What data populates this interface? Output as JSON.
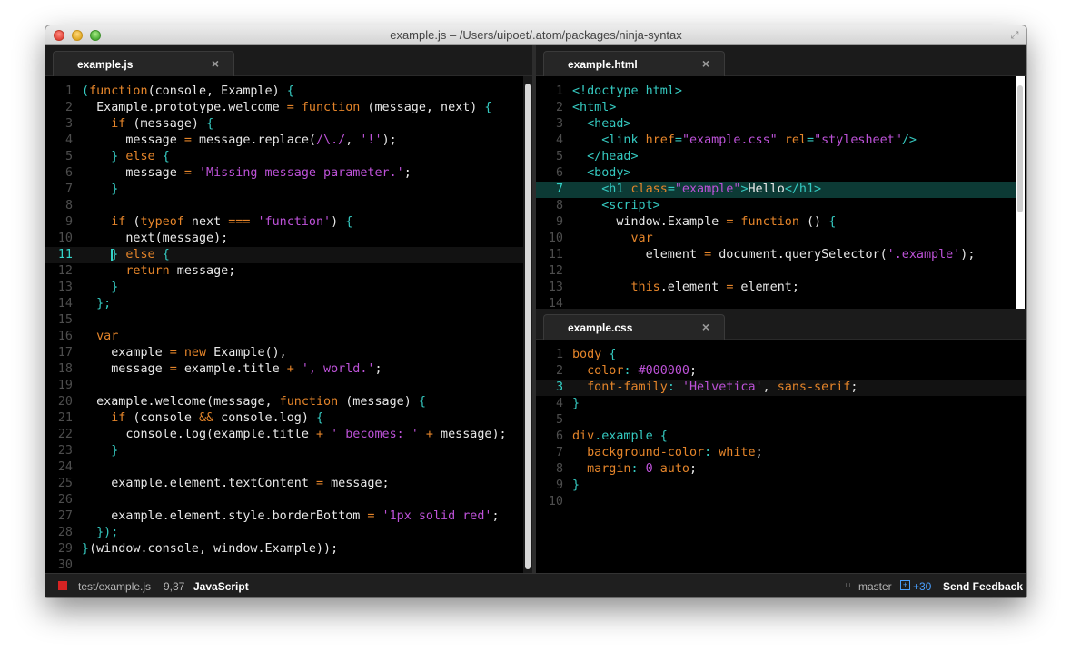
{
  "window": {
    "title": "example.js – /Users/uipoet/.atom/packages/ninja-syntax"
  },
  "left_pane": {
    "tab_label": "example.js",
    "close_glyph": "×"
  },
  "right_top_pane": {
    "tab_label": "example.html",
    "close_glyph": "×"
  },
  "right_bottom_pane": {
    "tab_label": "example.css",
    "close_glyph": "×"
  },
  "status": {
    "file_path": "test/example.js",
    "cursor": "9,37",
    "grammar": "JavaScript",
    "branch": "master",
    "diff_count": "+30",
    "feedback_label": "Send Feedback"
  },
  "colors": {
    "keyword": "#e5852a",
    "string": "#bd52d8",
    "punctuation": "#35c9c0",
    "text": "#e8e8e8",
    "gutter": "#4d4d4d",
    "cursor_line": "#34d2c7"
  },
  "icons": [
    "close-light-icon",
    "minimize-light-icon",
    "maximize-light-icon",
    "fullscreen-icon",
    "branch-icon",
    "diff-icon",
    "file-status-icon",
    "close-tab-icon"
  ],
  "left_code": [
    {
      "n": "1",
      "segs": [
        [
          "p",
          "("
        ],
        [
          "k",
          "function"
        ],
        [
          "",
          "(console, Example) "
        ],
        [
          "p",
          "{"
        ]
      ]
    },
    {
      "n": "2",
      "segs": [
        [
          "",
          "  Example.prototype.welcome "
        ],
        [
          "k",
          "="
        ],
        [
          "k",
          " function"
        ],
        [
          "",
          " (message, next) "
        ],
        [
          "p",
          "{"
        ]
      ]
    },
    {
      "n": "3",
      "segs": [
        [
          "",
          "    "
        ],
        [
          "k",
          "if"
        ],
        [
          "",
          " (message) "
        ],
        [
          "p",
          "{"
        ]
      ]
    },
    {
      "n": "4",
      "segs": [
        [
          "",
          "      message "
        ],
        [
          "k",
          "="
        ],
        [
          "",
          " message.replace("
        ],
        [
          "s",
          "/\\./"
        ],
        [
          ", "
        ],
        [
          "s",
          "'!'"
        ],
        [
          ");"
        ]
      ]
    },
    {
      "n": "5",
      "segs": [
        [
          "",
          "    "
        ],
        [
          "p",
          "}"
        ],
        [
          "k",
          " else "
        ],
        [
          "p",
          "{"
        ]
      ]
    },
    {
      "n": "6",
      "segs": [
        [
          "",
          "      message "
        ],
        [
          "k",
          "="
        ],
        [
          " ",
          ""
        ],
        [
          "s",
          "'Missing message parameter.'"
        ],
        [
          ";"
        ]
      ]
    },
    {
      "n": "7",
      "segs": [
        [
          "",
          "    "
        ],
        [
          "p",
          "}"
        ]
      ]
    },
    {
      "n": "8",
      "segs": []
    },
    {
      "n": "9",
      "segs": [
        [
          "",
          "    "
        ],
        [
          "k",
          "if"
        ],
        [
          "",
          " ("
        ],
        [
          "k",
          "typeof"
        ],
        [
          "",
          " next "
        ],
        [
          "k",
          "==="
        ],
        [
          " ",
          ""
        ],
        [
          "s",
          "'function'"
        ],
        [
          ") "
        ],
        [
          "p",
          "{"
        ]
      ]
    },
    {
      "n": "10",
      "segs": [
        [
          "",
          "      next(message);"
        ]
      ]
    },
    {
      "n": "11",
      "segs": [
        [
          "",
          "    "
        ],
        [
          "p",
          "}"
        ],
        [
          "k",
          " else "
        ],
        [
          "p",
          "{"
        ]
      ]
    },
    {
      "n": "12",
      "segs": [
        [
          "",
          "      "
        ],
        [
          "k",
          "return"
        ],
        [
          "",
          " message;"
        ]
      ]
    },
    {
      "n": "13",
      "segs": [
        [
          "",
          "    "
        ],
        [
          "p",
          "}"
        ]
      ]
    },
    {
      "n": "14",
      "segs": [
        [
          "",
          "  "
        ],
        [
          "p",
          "};"
        ]
      ]
    },
    {
      "n": "15",
      "segs": []
    },
    {
      "n": "16",
      "segs": [
        [
          "",
          "  "
        ],
        [
          "k",
          "var"
        ]
      ]
    },
    {
      "n": "17",
      "segs": [
        [
          "",
          "    example "
        ],
        [
          "k",
          "="
        ],
        [
          "k",
          " new"
        ],
        [
          "",
          " Example(),"
        ]
      ]
    },
    {
      "n": "18",
      "segs": [
        [
          "",
          "    message "
        ],
        [
          "k",
          "="
        ],
        [
          "",
          " example.title "
        ],
        [
          "k",
          "+"
        ],
        [
          " ",
          ""
        ],
        [
          "s",
          "', world.'"
        ],
        [
          ";"
        ]
      ]
    },
    {
      "n": "19",
      "segs": []
    },
    {
      "n": "20",
      "segs": [
        [
          "",
          "  example.welcome(message, "
        ],
        [
          "k",
          "function"
        ],
        [
          "",
          " (message) "
        ],
        [
          "p",
          "{"
        ]
      ]
    },
    {
      "n": "21",
      "segs": [
        [
          "",
          "    "
        ],
        [
          "k",
          "if"
        ],
        [
          "",
          " (console "
        ],
        [
          "k",
          "&&"
        ],
        [
          "",
          " console.log) "
        ],
        [
          "p",
          "{"
        ]
      ]
    },
    {
      "n": "22",
      "segs": [
        [
          "",
          "      console.log(example.title "
        ],
        [
          "k",
          "+"
        ],
        [
          " ",
          ""
        ],
        [
          "s",
          "' becomes: '"
        ],
        [
          " "
        ],
        [
          "k",
          "+"
        ],
        [
          "",
          " message);"
        ]
      ]
    },
    {
      "n": "23",
      "segs": [
        [
          "",
          "    "
        ],
        [
          "p",
          "}"
        ]
      ]
    },
    {
      "n": "24",
      "segs": []
    },
    {
      "n": "25",
      "segs": [
        [
          "",
          "    example.element.textContent "
        ],
        [
          "k",
          "="
        ],
        [
          "",
          " message;"
        ]
      ]
    },
    {
      "n": "26",
      "segs": []
    },
    {
      "n": "27",
      "segs": [
        [
          "",
          "    example.element.style.borderBottom "
        ],
        [
          "k",
          "="
        ],
        [
          " ",
          ""
        ],
        [
          "s",
          "'1px solid red'"
        ],
        [
          ";"
        ]
      ]
    },
    {
      "n": "28",
      "segs": [
        [
          "",
          "  "
        ],
        [
          "p",
          "});"
        ]
      ]
    },
    {
      "n": "29",
      "segs": [
        [
          "p",
          "}"
        ],
        [
          "",
          "(window.console, window.Example));"
        ]
      ]
    },
    {
      "n": "30",
      "segs": []
    }
  ],
  "html_code": [
    {
      "n": "1",
      "segs": [
        [
          "p",
          "<!doctype html>"
        ]
      ]
    },
    {
      "n": "2",
      "segs": [
        [
          "p",
          "<html>"
        ]
      ]
    },
    {
      "n": "3",
      "segs": [
        [
          "",
          "  "
        ],
        [
          "p",
          "<head>"
        ]
      ]
    },
    {
      "n": "4",
      "segs": [
        [
          "",
          "    "
        ],
        [
          "p",
          "<link "
        ],
        [
          "k",
          "href"
        ],
        [
          "p",
          "="
        ],
        [
          "s",
          "\"example.css\""
        ],
        [
          " ",
          ""
        ],
        [
          "k",
          "rel"
        ],
        [
          "p",
          "="
        ],
        [
          "s",
          "\"stylesheet\""
        ],
        [
          "p",
          "/>"
        ]
      ]
    },
    {
      "n": "5",
      "segs": [
        [
          "",
          "  "
        ],
        [
          "p",
          "</head>"
        ]
      ]
    },
    {
      "n": "6",
      "segs": [
        [
          "",
          "  "
        ],
        [
          "p",
          "<body>"
        ]
      ]
    },
    {
      "n": "7",
      "segs": [
        [
          "",
          "    "
        ],
        [
          "p",
          "<h1 "
        ],
        [
          "k",
          "class"
        ],
        [
          "p",
          "="
        ],
        [
          "s",
          "\"example\""
        ],
        [
          "p",
          ">"
        ],
        [
          "",
          "Hello"
        ],
        [
          "p",
          "</h1>"
        ]
      ]
    },
    {
      "n": "8",
      "segs": [
        [
          "",
          "    "
        ],
        [
          "p",
          "<script>"
        ]
      ]
    },
    {
      "n": "9",
      "segs": [
        [
          "",
          "      window.Example "
        ],
        [
          "k",
          "="
        ],
        [
          "k",
          " function"
        ],
        [
          "",
          " () "
        ],
        [
          "p",
          "{"
        ]
      ]
    },
    {
      "n": "10",
      "segs": [
        [
          "",
          "        "
        ],
        [
          "k",
          "var"
        ]
      ]
    },
    {
      "n": "11",
      "segs": [
        [
          "",
          "          element "
        ],
        [
          "k",
          "="
        ],
        [
          "",
          " document.querySelector("
        ],
        [
          "s",
          "'.example'"
        ],
        [
          ");"
        ]
      ]
    },
    {
      "n": "12",
      "segs": []
    },
    {
      "n": "13",
      "segs": [
        [
          "",
          "        "
        ],
        [
          "k",
          "this"
        ],
        [
          "",
          ".element "
        ],
        [
          "k",
          "="
        ],
        [
          "",
          " element;"
        ]
      ]
    },
    {
      "n": "14",
      "segs": []
    }
  ],
  "css_code": [
    {
      "n": "1",
      "segs": [
        [
          "k",
          "body"
        ],
        [
          " ",
          ""
        ],
        [
          "p",
          "{"
        ]
      ]
    },
    {
      "n": "2",
      "segs": [
        [
          "",
          "  "
        ],
        [
          "k",
          "color"
        ],
        [
          "p",
          ":"
        ],
        [
          " ",
          ""
        ],
        [
          "s",
          "#000000"
        ],
        [
          ";"
        ]
      ]
    },
    {
      "n": "3",
      "segs": [
        [
          "",
          "  "
        ],
        [
          "k",
          "font-family"
        ],
        [
          "p",
          ":"
        ],
        [
          " ",
          ""
        ],
        [
          "s",
          "'Helvetica'"
        ],
        [
          ", "
        ],
        [
          "k",
          "sans-serif"
        ],
        [
          ";"
        ]
      ]
    },
    {
      "n": "4",
      "segs": [
        [
          "p",
          "}"
        ]
      ]
    },
    {
      "n": "5",
      "segs": []
    },
    {
      "n": "6",
      "segs": [
        [
          "k",
          "div"
        ],
        [
          "p",
          ".example"
        ],
        [
          " ",
          ""
        ],
        [
          "p",
          "{"
        ]
      ]
    },
    {
      "n": "7",
      "segs": [
        [
          "",
          "  "
        ],
        [
          "k",
          "background-color"
        ],
        [
          "p",
          ":"
        ],
        [
          " ",
          ""
        ],
        [
          "k",
          "white"
        ],
        [
          ";"
        ]
      ]
    },
    {
      "n": "8",
      "segs": [
        [
          "",
          "  "
        ],
        [
          "k",
          "margin"
        ],
        [
          "p",
          ":"
        ],
        [
          " ",
          ""
        ],
        [
          "s",
          "0"
        ],
        [
          " ",
          ""
        ],
        [
          "k",
          "auto"
        ],
        [
          ";"
        ]
      ]
    },
    {
      "n": "9",
      "segs": [
        [
          "p",
          "}"
        ]
      ]
    },
    {
      "n": "10",
      "segs": []
    }
  ]
}
